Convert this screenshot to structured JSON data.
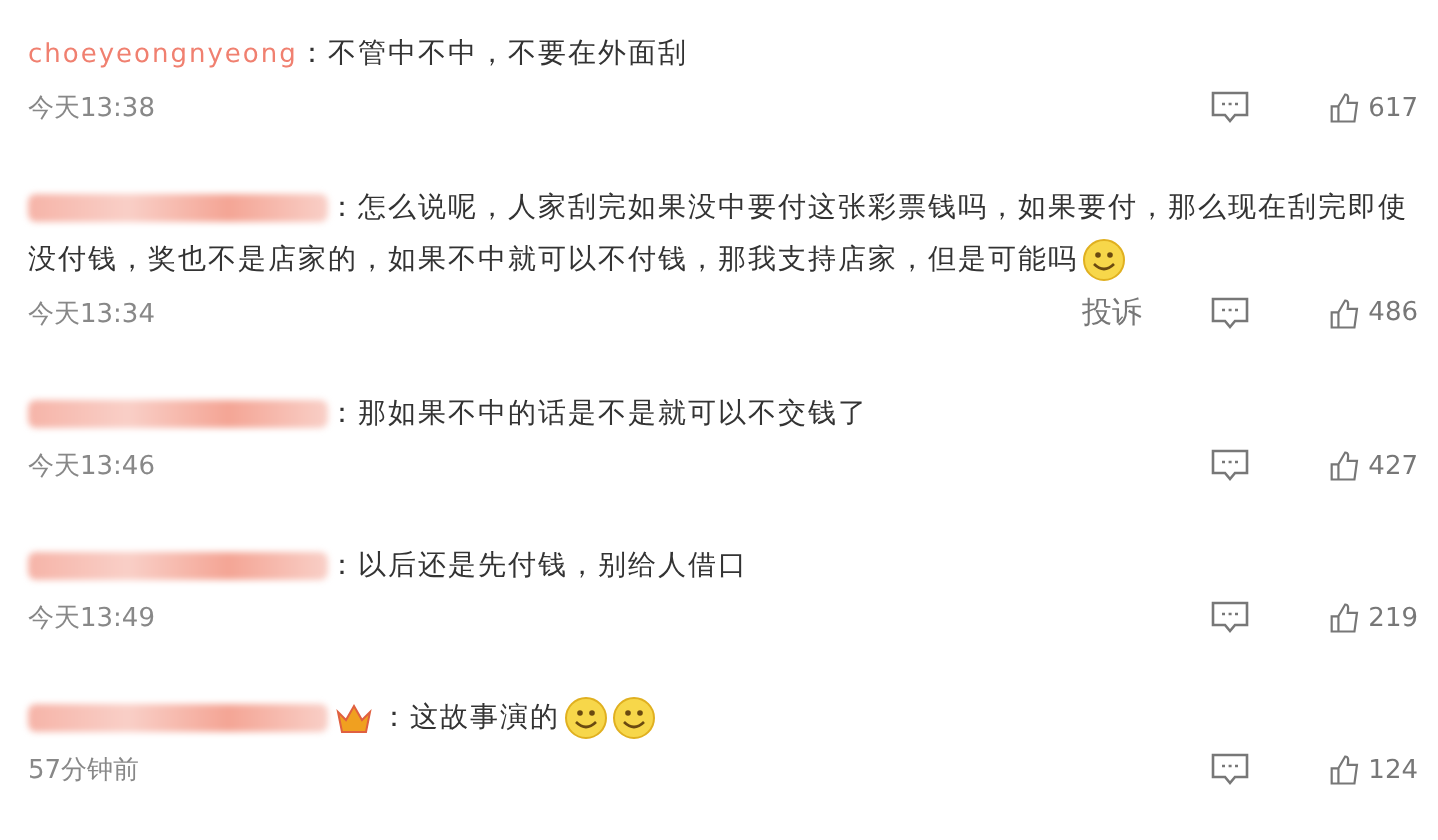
{
  "comments": [
    {
      "author": {
        "kind": "text",
        "text": "choeyeongnyeong"
      },
      "badge": false,
      "text": "：不管中不中，不要在外面刮",
      "time": "今天13:38",
      "likes": "617"
    },
    {
      "author": {
        "kind": "blurred"
      },
      "badge": false,
      "text": "：怎么说呢，人家刮完如果没中要付这张彩票钱吗，如果要付，那么现在刮完即使没付钱，奖也不是店家的，如果不中就可以不付钱，那我支持店家，但是可能吗",
      "emojis": [
        {
          "kind": "smile"
        }
      ],
      "time": "今天13:34",
      "report": "投诉",
      "likes": "486"
    },
    {
      "author": {
        "kind": "blurred"
      },
      "badge": false,
      "text": "：那如果不中的话是不是就可以不交钱了",
      "time": "今天13:46",
      "likes": "427"
    },
    {
      "author": {
        "kind": "blurred"
      },
      "badge": false,
      "text": "：以后还是先付钱，别给人借口",
      "time": "今天13:49",
      "likes": "219"
    },
    {
      "author": {
        "kind": "blurred"
      },
      "badge": true,
      "text": "：这故事演的",
      "emojis": [
        {
          "kind": "smile"
        },
        {
          "kind": "smile"
        }
      ],
      "time": "57分钟前",
      "likes": "124"
    }
  ]
}
